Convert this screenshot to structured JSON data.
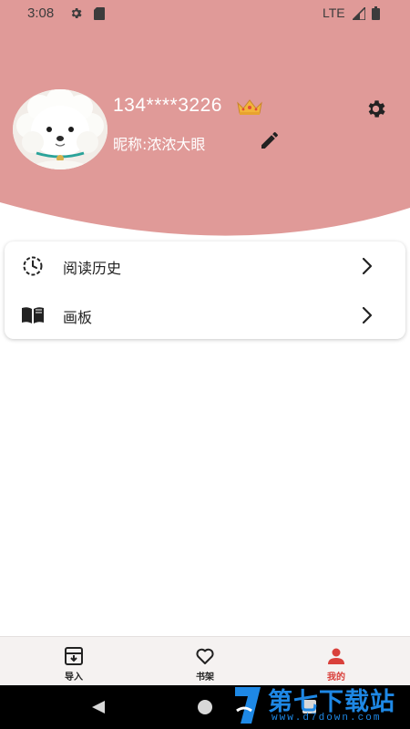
{
  "status_bar": {
    "time": "3:08",
    "network": "LTE",
    "icons": [
      "gear-icon",
      "sd-card-icon",
      "signal-icon",
      "battery-icon"
    ]
  },
  "profile": {
    "phone": "134****3226",
    "nickname": "昵称:浓浓大眼",
    "badge_icon": "crown-icon",
    "settings_icon": "gear-icon",
    "edit_icon": "pencil-icon"
  },
  "menu": {
    "items": [
      {
        "label": "阅读历史",
        "icon": "history-clock-icon"
      },
      {
        "label": "画板",
        "icon": "book-icon"
      }
    ]
  },
  "bottom_nav": {
    "items": [
      {
        "label": "导入",
        "icon": "import-tray-icon",
        "active": false
      },
      {
        "label": "书架",
        "icon": "heart-icon",
        "active": false
      },
      {
        "label": "我的",
        "icon": "person-icon",
        "active": true
      }
    ]
  },
  "watermark": {
    "title": "第七下载站",
    "url": "www.d7down.com"
  },
  "colors": {
    "header": "#e09a98",
    "accent": "#d9403b",
    "nav_bg": "#f5f2f1",
    "watermark": "#1e88e5"
  }
}
